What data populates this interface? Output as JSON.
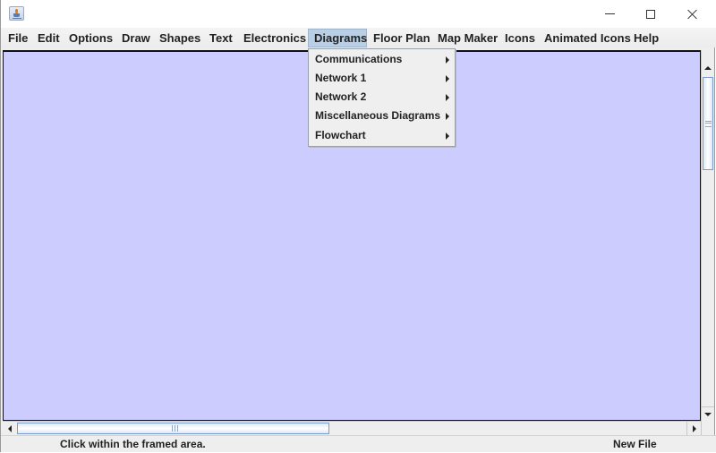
{
  "window": {
    "title": "",
    "controls": {
      "minimize": "minimize",
      "maximize": "maximize",
      "close": "close"
    }
  },
  "menubar": {
    "items": [
      {
        "label": "File"
      },
      {
        "label": "Edit"
      },
      {
        "label": "Options"
      },
      {
        "label": "Draw"
      },
      {
        "label": "Shapes"
      },
      {
        "label": "Text"
      },
      {
        "label": "Electronics"
      },
      {
        "label": "Diagrams",
        "active": true
      },
      {
        "label": "Floor Plan"
      },
      {
        "label": "Map Maker"
      },
      {
        "label": "Icons"
      },
      {
        "label": "Animated Icons"
      },
      {
        "label": "Help"
      }
    ]
  },
  "diagrams_menu": {
    "items": [
      {
        "label": "Communications",
        "has_submenu": true
      },
      {
        "label": "Network 1",
        "has_submenu": true
      },
      {
        "label": "Network 2",
        "has_submenu": true
      },
      {
        "label": "Miscellaneous Diagrams",
        "has_submenu": true
      },
      {
        "label": "Flowchart",
        "has_submenu": true
      }
    ]
  },
  "canvas": {
    "background_color": "#ccccff"
  },
  "statusbar": {
    "message": "Click within the framed area.",
    "file_status": "New File"
  }
}
